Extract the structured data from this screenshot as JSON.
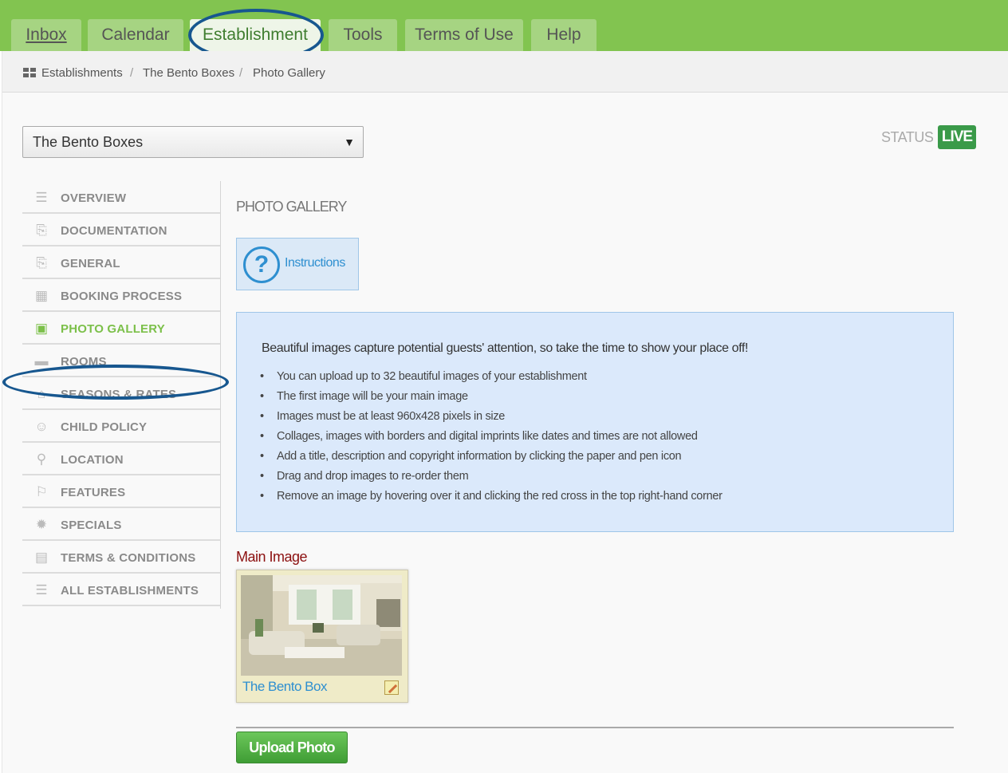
{
  "nav": {
    "tabs": [
      {
        "label": "Inbox"
      },
      {
        "label": "Calendar"
      },
      {
        "label": "Establishment",
        "active": true
      },
      {
        "label": "Tools"
      },
      {
        "label": "Terms of Use"
      },
      {
        "label": "Help"
      }
    ]
  },
  "breadcrumb": {
    "items": [
      "Establishments",
      "The Bento Boxes",
      "Photo Gallery"
    ],
    "separator": "/"
  },
  "establishment_select": {
    "value": "The Bento Boxes",
    "caret": "▼"
  },
  "status": {
    "label": "STATUS",
    "badge": "LIVE",
    "badge_color": "#3a9a49"
  },
  "sidebar": {
    "items": [
      {
        "label": "OVERVIEW",
        "icon": "list-icon",
        "glyph": "☰"
      },
      {
        "label": "DOCUMENTATION",
        "icon": "documents-icon",
        "glyph": "⎘"
      },
      {
        "label": "GENERAL",
        "icon": "documents-icon",
        "glyph": "⎘"
      },
      {
        "label": "BOOKING PROCESS",
        "icon": "calendar-icon",
        "glyph": "▦"
      },
      {
        "label": "PHOTO GALLERY",
        "icon": "photo-gallery-icon",
        "glyph": "▣",
        "active": true
      },
      {
        "label": "ROOMS",
        "icon": "bed-icon",
        "glyph": "▬"
      },
      {
        "label": "SEASONS & RATES",
        "icon": "house-icon",
        "glyph": "⌂"
      },
      {
        "label": "CHILD POLICY",
        "icon": "smiley-icon",
        "glyph": "☺"
      },
      {
        "label": "LOCATION",
        "icon": "map-pin-icon",
        "glyph": "⚲"
      },
      {
        "label": "FEATURES",
        "icon": "features-icon",
        "glyph": "⚐"
      },
      {
        "label": "SPECIALS",
        "icon": "specials-badge-icon",
        "glyph": "✹"
      },
      {
        "label": "TERMS & CONDITIONS",
        "icon": "clipboard-icon",
        "glyph": "▤"
      },
      {
        "label": "ALL ESTABLISHMENTS",
        "icon": "list-icon",
        "glyph": "☰"
      }
    ],
    "active_color": "#7cc04a"
  },
  "main": {
    "title": "PHOTO GALLERY",
    "instructions_button": {
      "label": "Instructions",
      "icon_glyph": "?"
    },
    "info": {
      "heading": "Beautiful images capture potential guests' attention, so take the time to show your place off!",
      "bullets": [
        "You can upload up to 32 beautiful images of your establishment",
        "The first image will be your main image",
        "Images must be at least 960x428 pixels in size",
        "Collages, images with borders and digital imprints like dates and times are not allowed",
        "Add a title, description and copyright information by clicking the paper and pen icon",
        "Drag and drop images to re-order them",
        "Remove an image by hovering over it and clicking the red cross in the top right-hand corner"
      ]
    },
    "main_image": {
      "label": "Main Image",
      "caption": "The Bento Box"
    },
    "upload_button": "Upload Photo"
  },
  "colors": {
    "topbar": "#82c450",
    "highlight_ring": "#17578f",
    "link": "#2e8fd0",
    "main_image_label": "#8c1010"
  }
}
